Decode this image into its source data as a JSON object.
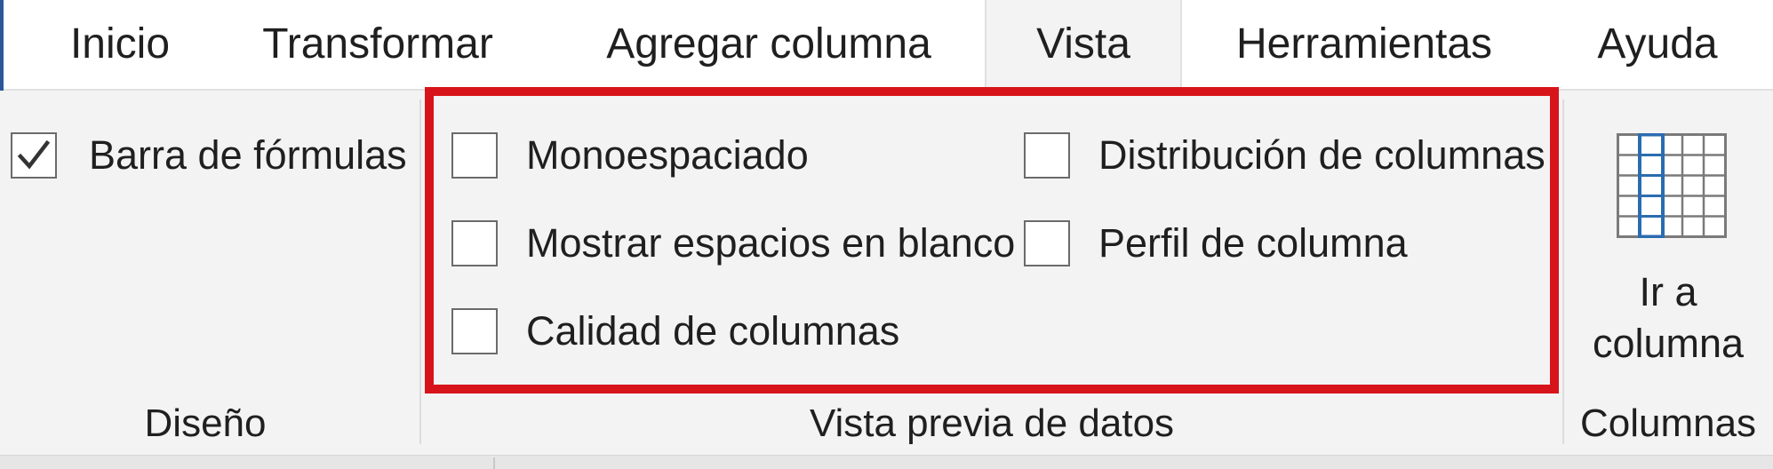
{
  "tabs": [
    {
      "label": "Inicio"
    },
    {
      "label": "Transformar"
    },
    {
      "label": "Agregar columna"
    },
    {
      "label": "Vista"
    },
    {
      "label": "Herramientas"
    },
    {
      "label": "Ayuda"
    }
  ],
  "active_tab": "Vista",
  "groups": {
    "diseno": {
      "label": "Diseño",
      "formula_bar": {
        "label": "Barra de fórmulas",
        "checked": true
      }
    },
    "vista_previa": {
      "label": "Vista previa de datos",
      "items": [
        {
          "label": "Monoespaciado",
          "checked": false
        },
        {
          "label": "Mostrar espacios en blanco",
          "checked": false
        },
        {
          "label": "Calidad de columnas",
          "checked": false
        },
        {
          "label": "Distribución de columnas",
          "checked": false
        },
        {
          "label": "Perfil de columna",
          "checked": false
        }
      ]
    },
    "columnas": {
      "label": "Columnas",
      "goto": {
        "line1": "Ir a",
        "line2": "columna",
        "icon": "column-grid-icon"
      }
    }
  },
  "colors": {
    "highlight": "#d8141b",
    "accent": "#2b579a",
    "ribbon_bg": "#f3f3f3"
  }
}
